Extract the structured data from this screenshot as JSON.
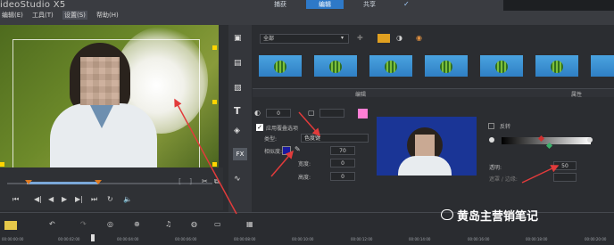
{
  "app": {
    "title": "ideoStudio X5"
  },
  "menu": {
    "items": [
      "编辑(E)",
      "工具(T)",
      "设置(S)",
      "帮助(H)"
    ]
  },
  "steps": {
    "tabs": [
      "捕获",
      "编辑",
      "共享"
    ],
    "active": 1
  },
  "preview": {
    "controls": [
      "⏮",
      "◀|",
      "◀",
      "▶",
      "▶|",
      "⏭",
      "↻",
      "🔈"
    ],
    "trim_labels": [
      "[",
      "]"
    ]
  },
  "library": {
    "category_select": "全部",
    "thumb_count": 7
  },
  "sections": {
    "left": "编辑",
    "right": "属性"
  },
  "overlay": {
    "frame_value": "0",
    "checkbox_label": "应用覆叠选项",
    "type_label": "类型:",
    "type_value": "色度键",
    "similarity_label": "相似度:",
    "similarity_value": "70",
    "width_label": "宽度:",
    "width_value": "0",
    "height_label": "高度:",
    "height_value": "0"
  },
  "mask": {
    "checkbox_label": "反转",
    "opacity_label": "透明:",
    "opacity_value": "50",
    "gradient_label": "遮罩 / 边缘:"
  },
  "timeline": {
    "ticks": [
      "00:00:00:00",
      "00:00:02:00",
      "00:00:04:00",
      "00:00:06:00",
      "00:00:08:00",
      "00:00:10:00",
      "00:00:12:00",
      "00:00:14:00",
      "00:00:16:00",
      "00:00:18:00",
      "00:00:20:00",
      "00:00:22:00"
    ]
  },
  "watermark": {
    "text": "黄岛主营销笔记"
  },
  "colors": {
    "accent": "#2e79c8",
    "arrow": "#e23b3b",
    "key_color": "#1a1aa0",
    "pink": "#ff7fd4"
  }
}
